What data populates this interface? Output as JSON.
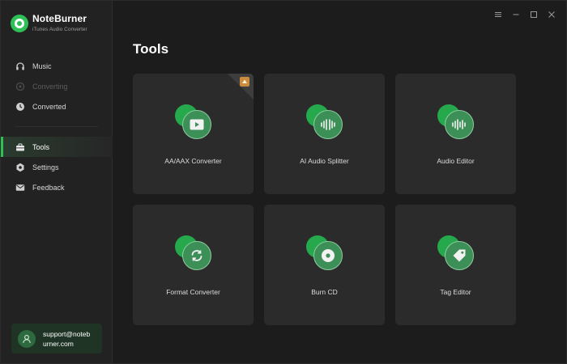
{
  "app": {
    "name": "NoteBurner",
    "subtitle": "iTunes Audio Converter"
  },
  "sidebar": {
    "items": [
      {
        "label": "Music",
        "icon": "headphones-icon",
        "state": "normal"
      },
      {
        "label": "Converting",
        "icon": "converting-icon",
        "state": "disabled"
      },
      {
        "label": "Converted",
        "icon": "clock-icon",
        "state": "normal"
      },
      {
        "label": "Tools",
        "icon": "toolbox-icon",
        "state": "active"
      },
      {
        "label": "Settings",
        "icon": "gear-icon",
        "state": "normal"
      },
      {
        "label": "Feedback",
        "icon": "mail-icon",
        "state": "normal"
      }
    ],
    "account": {
      "email_line1": "support@noteb",
      "email_line2": "urner.com"
    }
  },
  "window_controls": [
    "menu-icon",
    "minimize-icon",
    "maximize-icon",
    "close-icon"
  ],
  "main": {
    "title": "Tools",
    "tools": [
      {
        "label": "AA/AAX Converter",
        "icon": "play-video-icon",
        "badge": "new-badge-icon"
      },
      {
        "label": "AI Audio Splitter",
        "icon": "waveform-icon"
      },
      {
        "label": "Audio Editor",
        "icon": "waveform-icon"
      },
      {
        "label": "Format Converter",
        "icon": "refresh-icon"
      },
      {
        "label": "Burn CD",
        "icon": "disc-icon"
      },
      {
        "label": "Tag Editor",
        "icon": "tag-icon"
      }
    ]
  },
  "colors": {
    "accent": "#2fbf57",
    "background": "#1c1c1c",
    "sidebar": "#222222",
    "card": "#2b2b2b"
  }
}
